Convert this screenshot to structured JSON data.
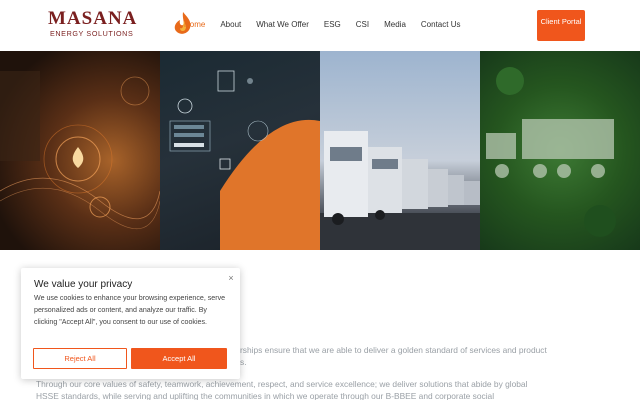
{
  "brand": {
    "name": "MASANA",
    "tagline": "ENERGY SOLUTIONS",
    "accent_color": "#f0561c",
    "brand_color": "#7a1f1f"
  },
  "nav": {
    "items": [
      {
        "label": "Home",
        "active": true
      },
      {
        "label": "About"
      },
      {
        "label": "What We Offer"
      },
      {
        "label": "ESG"
      },
      {
        "label": "CSI"
      },
      {
        "label": "Media"
      },
      {
        "label": "Contact Us"
      }
    ],
    "portal_button": "Client Portal"
  },
  "hero": {
    "panels": [
      {
        "subject": "fuel-tech-imagery"
      },
      {
        "subject": "digital-login-imagery"
      },
      {
        "subject": "fleet-of-trucks"
      },
      {
        "subject": "forest-truck-silhouette"
      }
    ]
  },
  "body": {
    "paragraph1_visible": "rships ensure that we are able to deliver a golden standard of services and product",
    "paragraph1_line2": "s.",
    "paragraph2_line1": "Through our core values of safety, teamwork, achievement, respect, and service excellence; we deliver solutions that abide by global",
    "paragraph2_line2": "HSSE standards, while serving and uplifting the communities in which we operate through our B-BBEE and corporate social"
  },
  "cookie_banner": {
    "title": "We value your privacy",
    "text": "We use cookies to enhance your browsing experience, serve personalized ads or content, and analyze our traffic. By clicking \"Accept All\", you consent to our use of cookies.",
    "reject_label": "Reject All",
    "accept_label": "Accept All",
    "close_icon": "×"
  }
}
